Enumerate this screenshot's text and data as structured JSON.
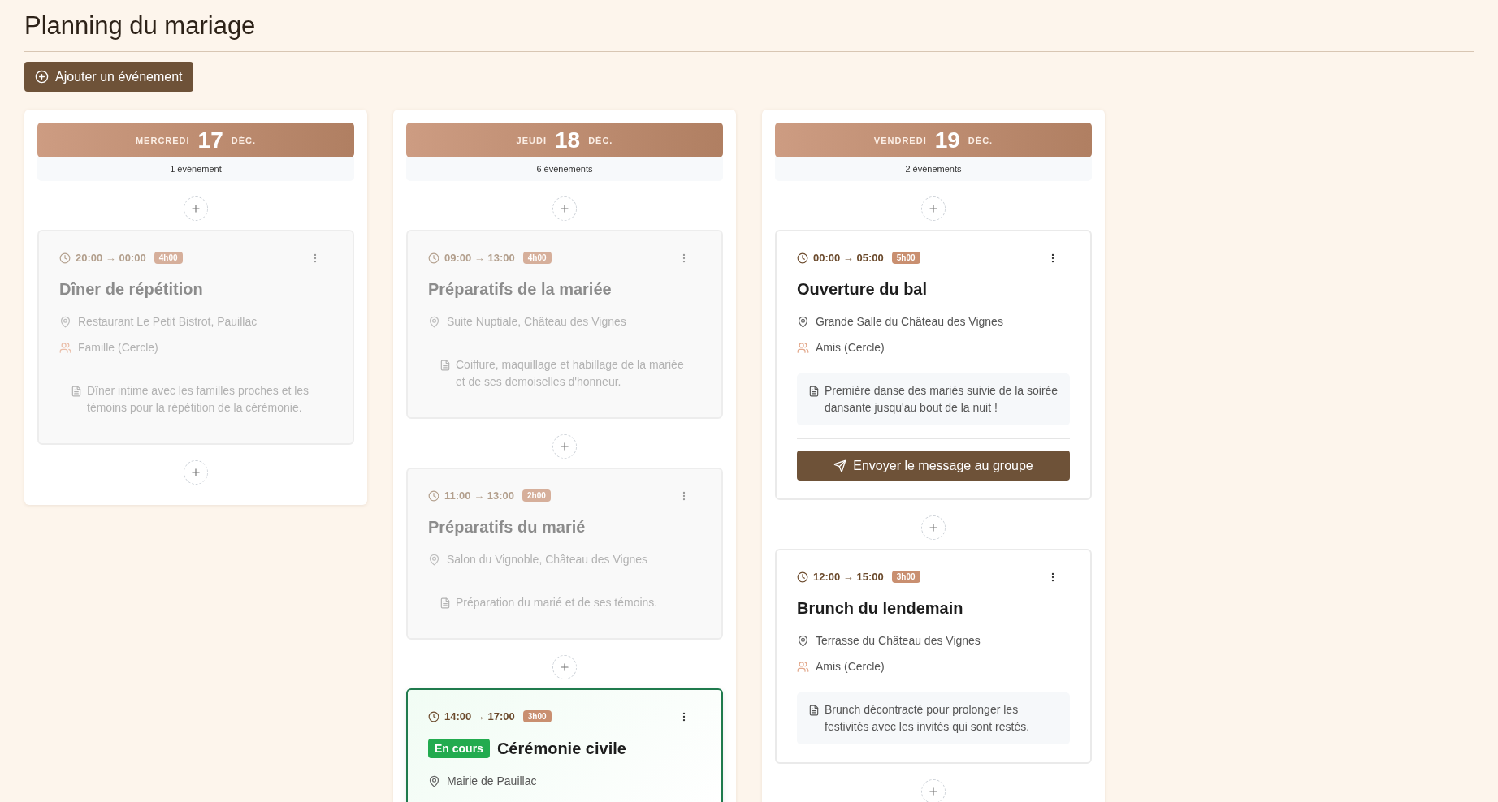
{
  "page": {
    "title": "Planning du mariage"
  },
  "add_button": {
    "label": "Ajouter un événement"
  },
  "days": [
    {
      "weekday": "MERCREDI",
      "day": "17",
      "month": "DÉC.",
      "count": "1 événement",
      "events": [
        {
          "kind": "past",
          "time": "20:00 → 00:00",
          "duration": "4h00",
          "title": "Dîner de répétition",
          "location": "Restaurant Le Petit Bistrot, Pauillac",
          "group": "Famille (Cercle)",
          "notes": "Dîner intime avec les familles proches et les témoins pour la répétition de la cérémonie."
        }
      ]
    },
    {
      "weekday": "JEUDI",
      "day": "18",
      "month": "DÉC.",
      "count": "6 événements",
      "events": [
        {
          "kind": "past",
          "time": "09:00 → 13:00",
          "duration": "4h00",
          "title": "Préparatifs de la mariée",
          "location": "Suite Nuptiale, Château des Vignes",
          "notes": "Coiffure, maquillage et habillage de la mariée et de ses demoiselles d'honneur."
        },
        {
          "kind": "past",
          "time": "11:00 → 13:00",
          "duration": "2h00",
          "title": "Préparatifs du marié",
          "location": "Salon du Vignoble, Château des Vignes",
          "notes": "Préparation du marié et de ses témoins."
        },
        {
          "kind": "current",
          "badge": "En cours",
          "time": "14:00 → 17:00",
          "duration": "3h00",
          "title": "Cérémonie civile",
          "location": "Mairie de Pauillac"
        }
      ]
    },
    {
      "weekday": "VENDREDI",
      "day": "19",
      "month": "DÉC.",
      "count": "2 événements",
      "events": [
        {
          "kind": "upcoming",
          "time": "00:00 → 05:00",
          "duration": "5h00",
          "title": "Ouverture du bal",
          "location": "Grande Salle du Château des Vignes",
          "group": "Amis (Cercle)",
          "notes": "Première danse des mariés suivie de la soirée dansante jusqu'au bout de la nuit !",
          "action": "Envoyer le message au groupe"
        },
        {
          "kind": "upcoming",
          "time": "12:00 → 15:00",
          "duration": "3h00",
          "title": "Brunch du lendemain",
          "location": "Terrasse du Château des Vignes",
          "group": "Amis (Cercle)",
          "notes": "Brunch décontracté pour prolonger les festivités avec les invités qui sont restés."
        }
      ]
    }
  ]
}
